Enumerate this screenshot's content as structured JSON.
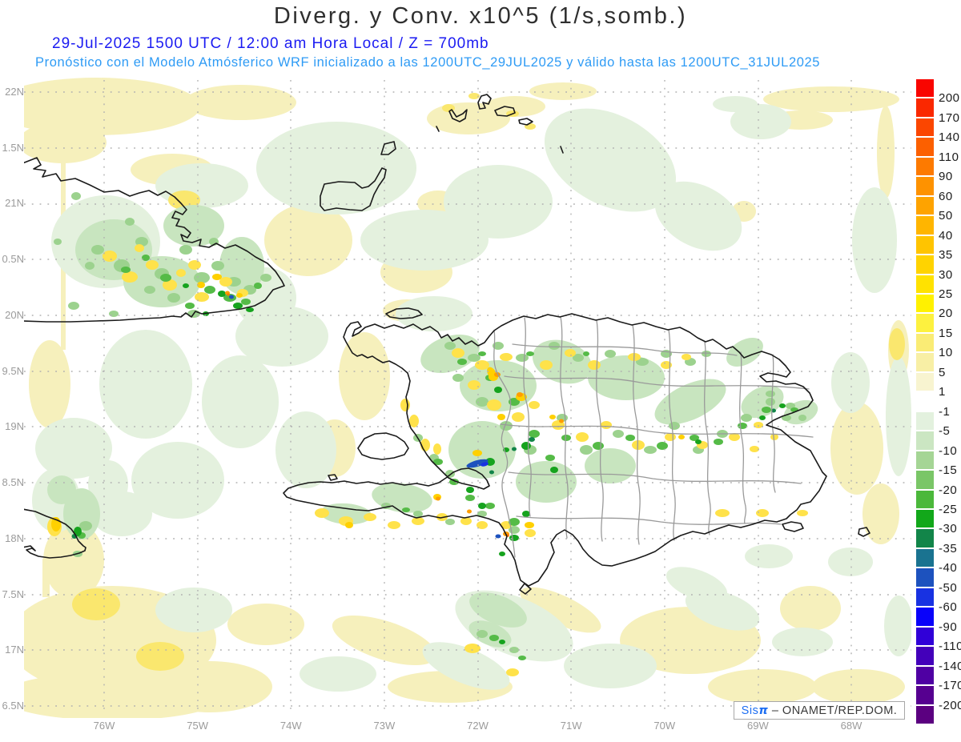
{
  "header": {
    "title": "Diverg. y Conv. x10^5 (1/s,somb.)",
    "subtitle1": "29-Jul-2025  1500 UTC / 12:00 am Hora Local / Z = 700mb",
    "subtitle2": "Pronóstico con el Modelo Atmósferico WRF inicializado a las 1200UTC_29JUL2025 y válido hasta las  1200UTC_31JUL2025"
  },
  "axes": {
    "lat_labels": [
      "22N",
      "1.5N",
      "21N",
      "0.5N",
      "20N",
      "9.5N",
      "19N",
      "8.5N",
      "18N",
      "7.5N",
      "17N",
      "6.5N"
    ],
    "lon_labels": [
      "76W",
      "75W",
      "74W",
      "73W",
      "72W",
      "71W",
      "70W",
      "69W",
      "68W"
    ]
  },
  "colorbar": {
    "labels": [
      "200",
      "170",
      "140",
      "110",
      "90",
      "60",
      "50",
      "40",
      "35",
      "30",
      "25",
      "20",
      "15",
      "10",
      "5",
      "1",
      "-1",
      "-5",
      "-10",
      "-15",
      "-20",
      "-25",
      "-30",
      "-35",
      "-40",
      "-50",
      "-60",
      "-90",
      "-110",
      "-140",
      "-170",
      "-200"
    ],
    "colors": [
      "#F90500",
      "#FA2800",
      "#FB4600",
      "#FC6000",
      "#FD7A00",
      "#FE9200",
      "#FEA300",
      "#FFB500",
      "#FFC400",
      "#FFD300",
      "#FFE200",
      "#FFF100",
      "#FDF13F",
      "#FAEC75",
      "#F8EFA5",
      "#F8F4D0",
      "#FFFFFF",
      "#E3F1DE",
      "#CBE6C2",
      "#A5D595",
      "#7AC667",
      "#4BB83B",
      "#12A81A",
      "#128549",
      "#1A7390",
      "#1D52BE",
      "#1832E2",
      "#0902FA",
      "#3000D8",
      "#4300BA",
      "#4F00A3",
      "#560090",
      "#5B0080"
    ]
  },
  "attribution": {
    "app_prefix": "Sis",
    "app_pi": "π",
    "org": " – ONAMET/REP.DOM."
  },
  "colors": {
    "title": "#2f2f2f",
    "subtitle1": "#1b1bf2",
    "subtitle2": "#2e9bf5",
    "axis_labels": "#9b9b9b",
    "attribution_app": "#1d6ef2",
    "attribution_org": "#3a3a3a",
    "coastline": "#1a1a1a",
    "province_border": "#9a9a9a",
    "graticule": "#b0b0b0"
  }
}
